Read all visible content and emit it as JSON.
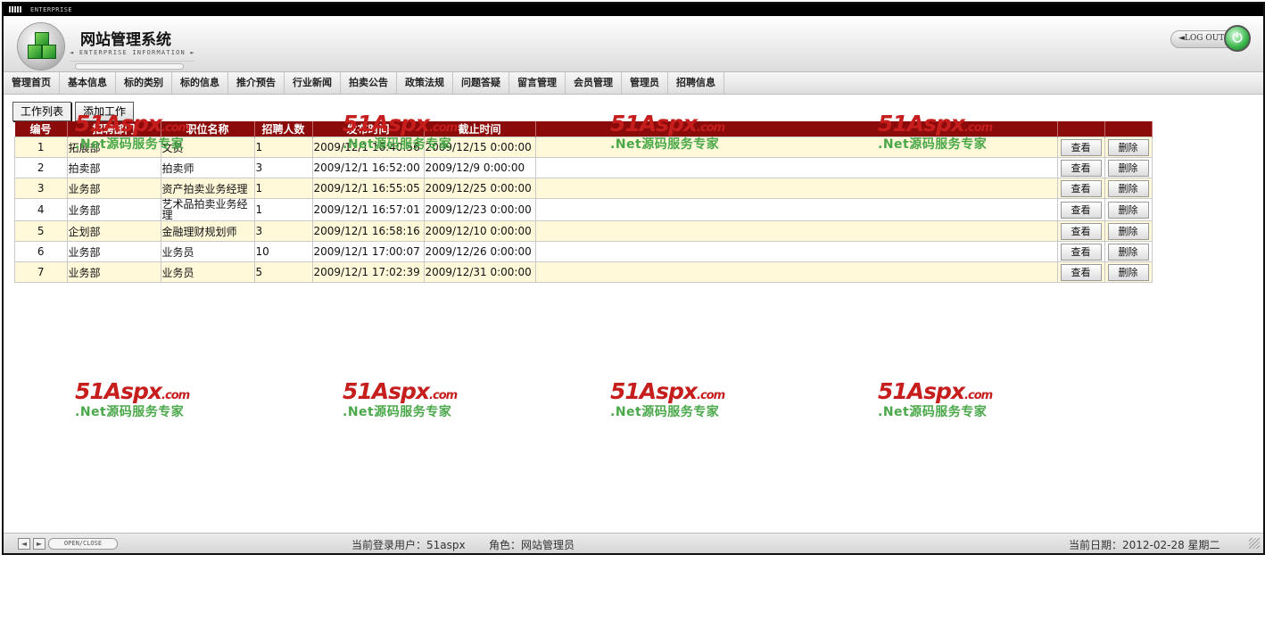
{
  "topbar": {
    "label": "ENTERPRISE"
  },
  "header": {
    "title": "网站管理系统",
    "subtitle": "◄ ENTERPRISE INFORMATION ►",
    "logout": "◄LOG OUT"
  },
  "nav": [
    "管理首页",
    "基本信息",
    "标的类别",
    "标的信息",
    "推介预告",
    "行业新闻",
    "拍卖公告",
    "政策法规",
    "问题答疑",
    "留言管理",
    "会员管理",
    "管理员",
    "招聘信息"
  ],
  "tabs": {
    "list": "工作列表",
    "add": "添加工作"
  },
  "table": {
    "headers": [
      "编号",
      "招聘部门",
      "职位名称",
      "招聘人数",
      "发布时间",
      "截止时间"
    ],
    "view_label": "查看",
    "delete_label": "删除",
    "rows": [
      {
        "id": "1",
        "dept": "拓展部",
        "pos": "文员",
        "num": "1",
        "pub": "2009/12/1 16:40:56",
        "end": "2009/12/15 0:00:00"
      },
      {
        "id": "2",
        "dept": "拍卖部",
        "pos": "拍卖师",
        "num": "3",
        "pub": "2009/12/1 16:52:00",
        "end": "2009/12/9 0:00:00"
      },
      {
        "id": "3",
        "dept": "业务部",
        "pos": "资产拍卖业务经理",
        "num": "1",
        "pub": "2009/12/1 16:55:05",
        "end": "2009/12/25 0:00:00"
      },
      {
        "id": "4",
        "dept": "业务部",
        "pos": "艺术品拍卖业务经理",
        "num": "1",
        "pub": "2009/12/1 16:57:01",
        "end": "2009/12/23 0:00:00"
      },
      {
        "id": "5",
        "dept": "企划部",
        "pos": "金融理财规划师",
        "num": "3",
        "pub": "2009/12/1 16:58:16",
        "end": "2009/12/10 0:00:00"
      },
      {
        "id": "6",
        "dept": "业务部",
        "pos": "业务员",
        "num": "10",
        "pub": "2009/12/1 17:00:07",
        "end": "2009/12/26 0:00:00"
      },
      {
        "id": "7",
        "dept": "业务部",
        "pos": "业务员",
        "num": "5",
        "pub": "2009/12/1 17:02:39",
        "end": "2009/12/31 0:00:00"
      }
    ]
  },
  "watermark": {
    "brand": "51Aspx",
    "domain": ".com",
    "slogan": ".Net源码服务专家"
  },
  "status": {
    "open_close": "OPEN/CLOSE",
    "user": "当前登录用户：51aspx",
    "role": "角色：网站管理员",
    "date": "当前日期：2012-02-28 星期二"
  },
  "colors": {
    "header_row": "#8b0a0a",
    "odd_row": "#fff8d9",
    "watermark_red": "#c61d1d",
    "watermark_green": "#4aa84a"
  }
}
